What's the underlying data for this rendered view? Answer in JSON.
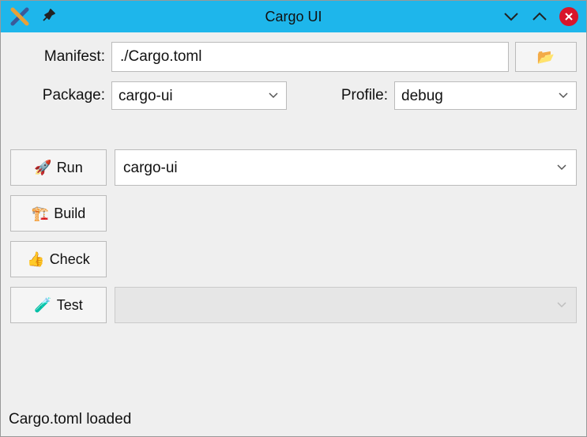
{
  "window": {
    "title": "Cargo UI"
  },
  "form": {
    "manifest_label": "Manifest:",
    "manifest_value": "./Cargo.toml",
    "package_label": "Package:",
    "package_value": "cargo-ui",
    "profile_label": "Profile:",
    "profile_value": "debug"
  },
  "actions": {
    "run_label": "Run",
    "run_target": "cargo-ui",
    "build_label": "Build",
    "check_label": "Check",
    "test_label": "Test",
    "test_target": ""
  },
  "icons": {
    "run": "🚀",
    "build": "🏗️",
    "check": "👍",
    "test": "🧪",
    "browse": "📂"
  },
  "status": {
    "message": "Cargo.toml loaded"
  }
}
